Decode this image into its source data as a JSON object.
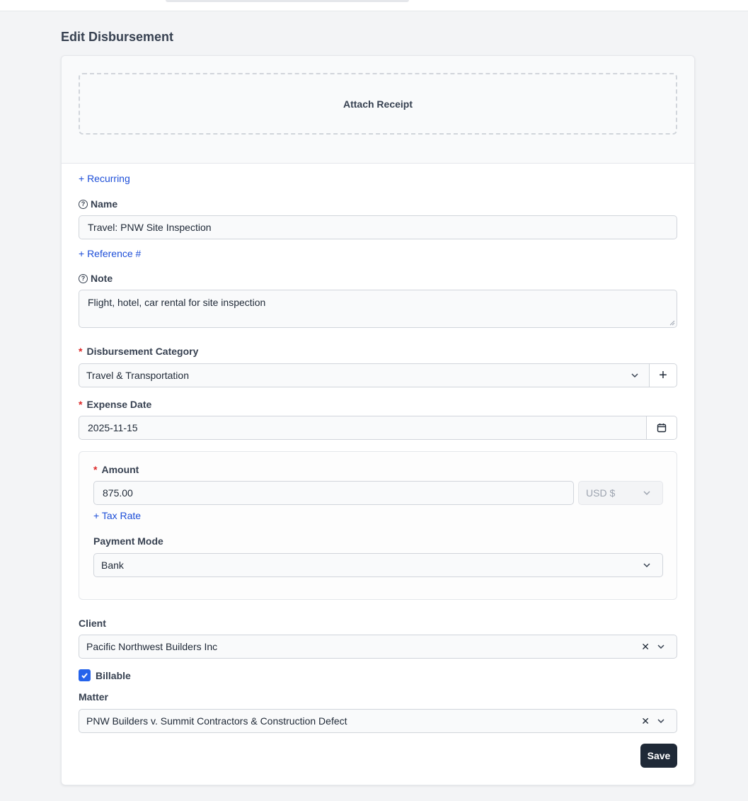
{
  "page": {
    "title": "Edit Disbursement"
  },
  "attach": {
    "label": "Attach Receipt"
  },
  "links": {
    "recurring": "+ Recurring",
    "reference": "+ Reference #",
    "tax_rate": "+ Tax Rate"
  },
  "fields": {
    "name": {
      "label": "Name",
      "value": "Travel: PNW Site Inspection"
    },
    "note": {
      "label": "Note",
      "value": "Flight, hotel, car rental for site inspection"
    },
    "category": {
      "label": "Disbursement Category",
      "value": "Travel & Transportation",
      "add_label": "+"
    },
    "expense_date": {
      "label": "Expense Date",
      "value": "2025-11-15"
    },
    "amount": {
      "label": "Amount",
      "value": "875.00",
      "currency": "USD $"
    },
    "payment_mode": {
      "label": "Payment Mode",
      "value": "Bank"
    },
    "client": {
      "label": "Client",
      "value": "Pacific Northwest Builders Inc",
      "clear": "✕"
    },
    "billable": {
      "label": "Billable",
      "checked": true
    },
    "matter": {
      "label": "Matter",
      "value": "PNW Builders v. Summit Contractors & Construction Defect",
      "clear": "✕"
    }
  },
  "required_mark": "*",
  "help_glyph": "?",
  "actions": {
    "save": "Save"
  },
  "colors": {
    "link": "#1d4ed8",
    "required": "#dc2626",
    "primary_button": "#1f2937",
    "checkbox": "#2563eb"
  }
}
